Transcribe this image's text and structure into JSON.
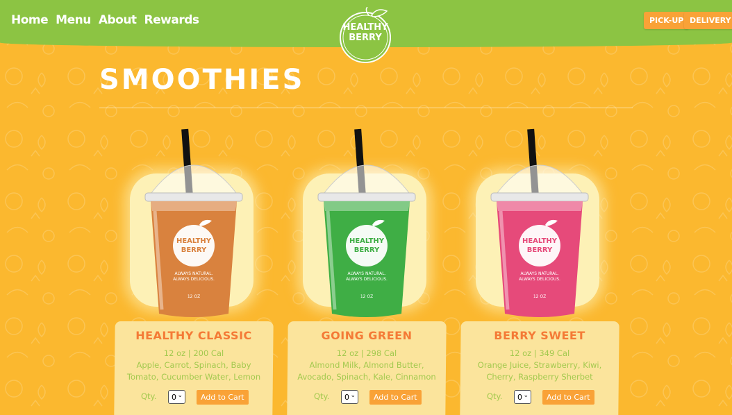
{
  "nav": [
    "Home",
    "Menu",
    "About",
    "Rewards"
  ],
  "logo": {
    "line1": "HEALTHY",
    "line2": "BERRY"
  },
  "header_buttons": {
    "pickup": "PICK-UP",
    "delivery": "DELIVERY"
  },
  "page_title": "SMOOTHIES",
  "colors": {
    "header": "#8cc443",
    "background": "#fbb82f",
    "accent": "#f9a237",
    "name": "#f47a36",
    "text": "#a3c94e"
  },
  "products": [
    {
      "name": "HEALTHY CLASSIC",
      "meta": "12 oz | 200 Cal",
      "desc": "Apple, Carrot, Spinach, Baby Tomato, Cucumber Water, Lemon",
      "qty_label": "Qty.",
      "qty": "0",
      "add": "Add to Cart",
      "color": "#d9823e"
    },
    {
      "name": "GOING GREEN",
      "meta": "12 oz | 298 Cal",
      "desc": "Almond Milk, Almond Butter, Avocado, Spinach, Kale, Cinnamon",
      "qty_label": "Qty.",
      "qty": "0",
      "add": "Add to Cart",
      "color": "#3fae45"
    },
    {
      "name": "BERRY SWEET",
      "meta": "12 oz | 349 Cal",
      "desc": "Orange Juice, Strawberry, Kiwi, Cherry, Raspberry Sherbet",
      "qty_label": "Qty.",
      "qty": "0",
      "add": "Add to Cart",
      "color": "#e64a7a"
    }
  ]
}
